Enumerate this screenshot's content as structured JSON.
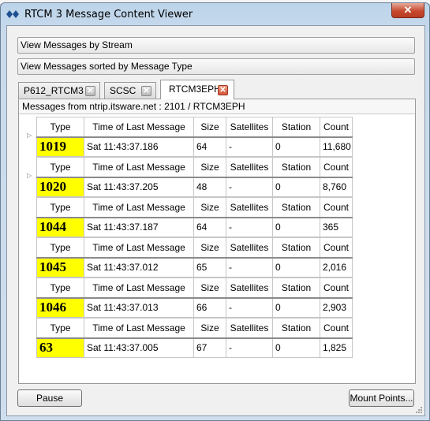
{
  "window": {
    "title": "RTCM 3 Message Content Viewer",
    "close_glyph": "✕"
  },
  "sections": {
    "by_stream": "View Messages by Stream",
    "by_type": "View Messages sorted by Message Type"
  },
  "tabs": [
    {
      "label": "P612_RTCM3",
      "close_glyph": "✕",
      "active": false
    },
    {
      "label": "SCSC",
      "close_glyph": "✕",
      "active": false
    },
    {
      "label": "RTCM3EPH",
      "close_glyph": "✕",
      "active": true
    }
  ],
  "panel": {
    "header": "Messages from ntrip.itsware.net : 2101 / RTCM3EPH"
  },
  "columns": {
    "type": "Type",
    "time": "Time of Last Message",
    "size": "Size",
    "satellites": "Satellites",
    "station": "Station",
    "count": "Count"
  },
  "messages": [
    {
      "type": "1019",
      "time": "Sat 11:43:37.186",
      "size": "64",
      "satellites": "-",
      "station": "0",
      "count": "11,680",
      "expandable": true
    },
    {
      "type": "1020",
      "time": "Sat 11:43:37.205",
      "size": "48",
      "satellites": "-",
      "station": "0",
      "count": "8,760",
      "expandable": true
    },
    {
      "type": "1044",
      "time": "Sat 11:43:37.187",
      "size": "64",
      "satellites": "-",
      "station": "0",
      "count": "365",
      "expandable": false
    },
    {
      "type": "1045",
      "time": "Sat 11:43:37.012",
      "size": "65",
      "satellites": "-",
      "station": "0",
      "count": "2,016",
      "expandable": false
    },
    {
      "type": "1046",
      "time": "Sat 11:43:37.013",
      "size": "66",
      "satellites": "-",
      "station": "0",
      "count": "2,903",
      "expandable": false
    },
    {
      "type": "63",
      "time": "Sat 11:43:37.005",
      "size": "67",
      "satellites": "-",
      "station": "0",
      "count": "1,825",
      "expandable": false
    }
  ],
  "buttons": {
    "pause": "Pause",
    "mount_points": "Mount Points..."
  },
  "colors": {
    "type_highlight": "#ffff00",
    "close_button": "#c74a30"
  },
  "icons": {
    "app": "double-diamond-icon",
    "expand": "expand-arrow-icon",
    "resize": "resize-grip-icon"
  }
}
